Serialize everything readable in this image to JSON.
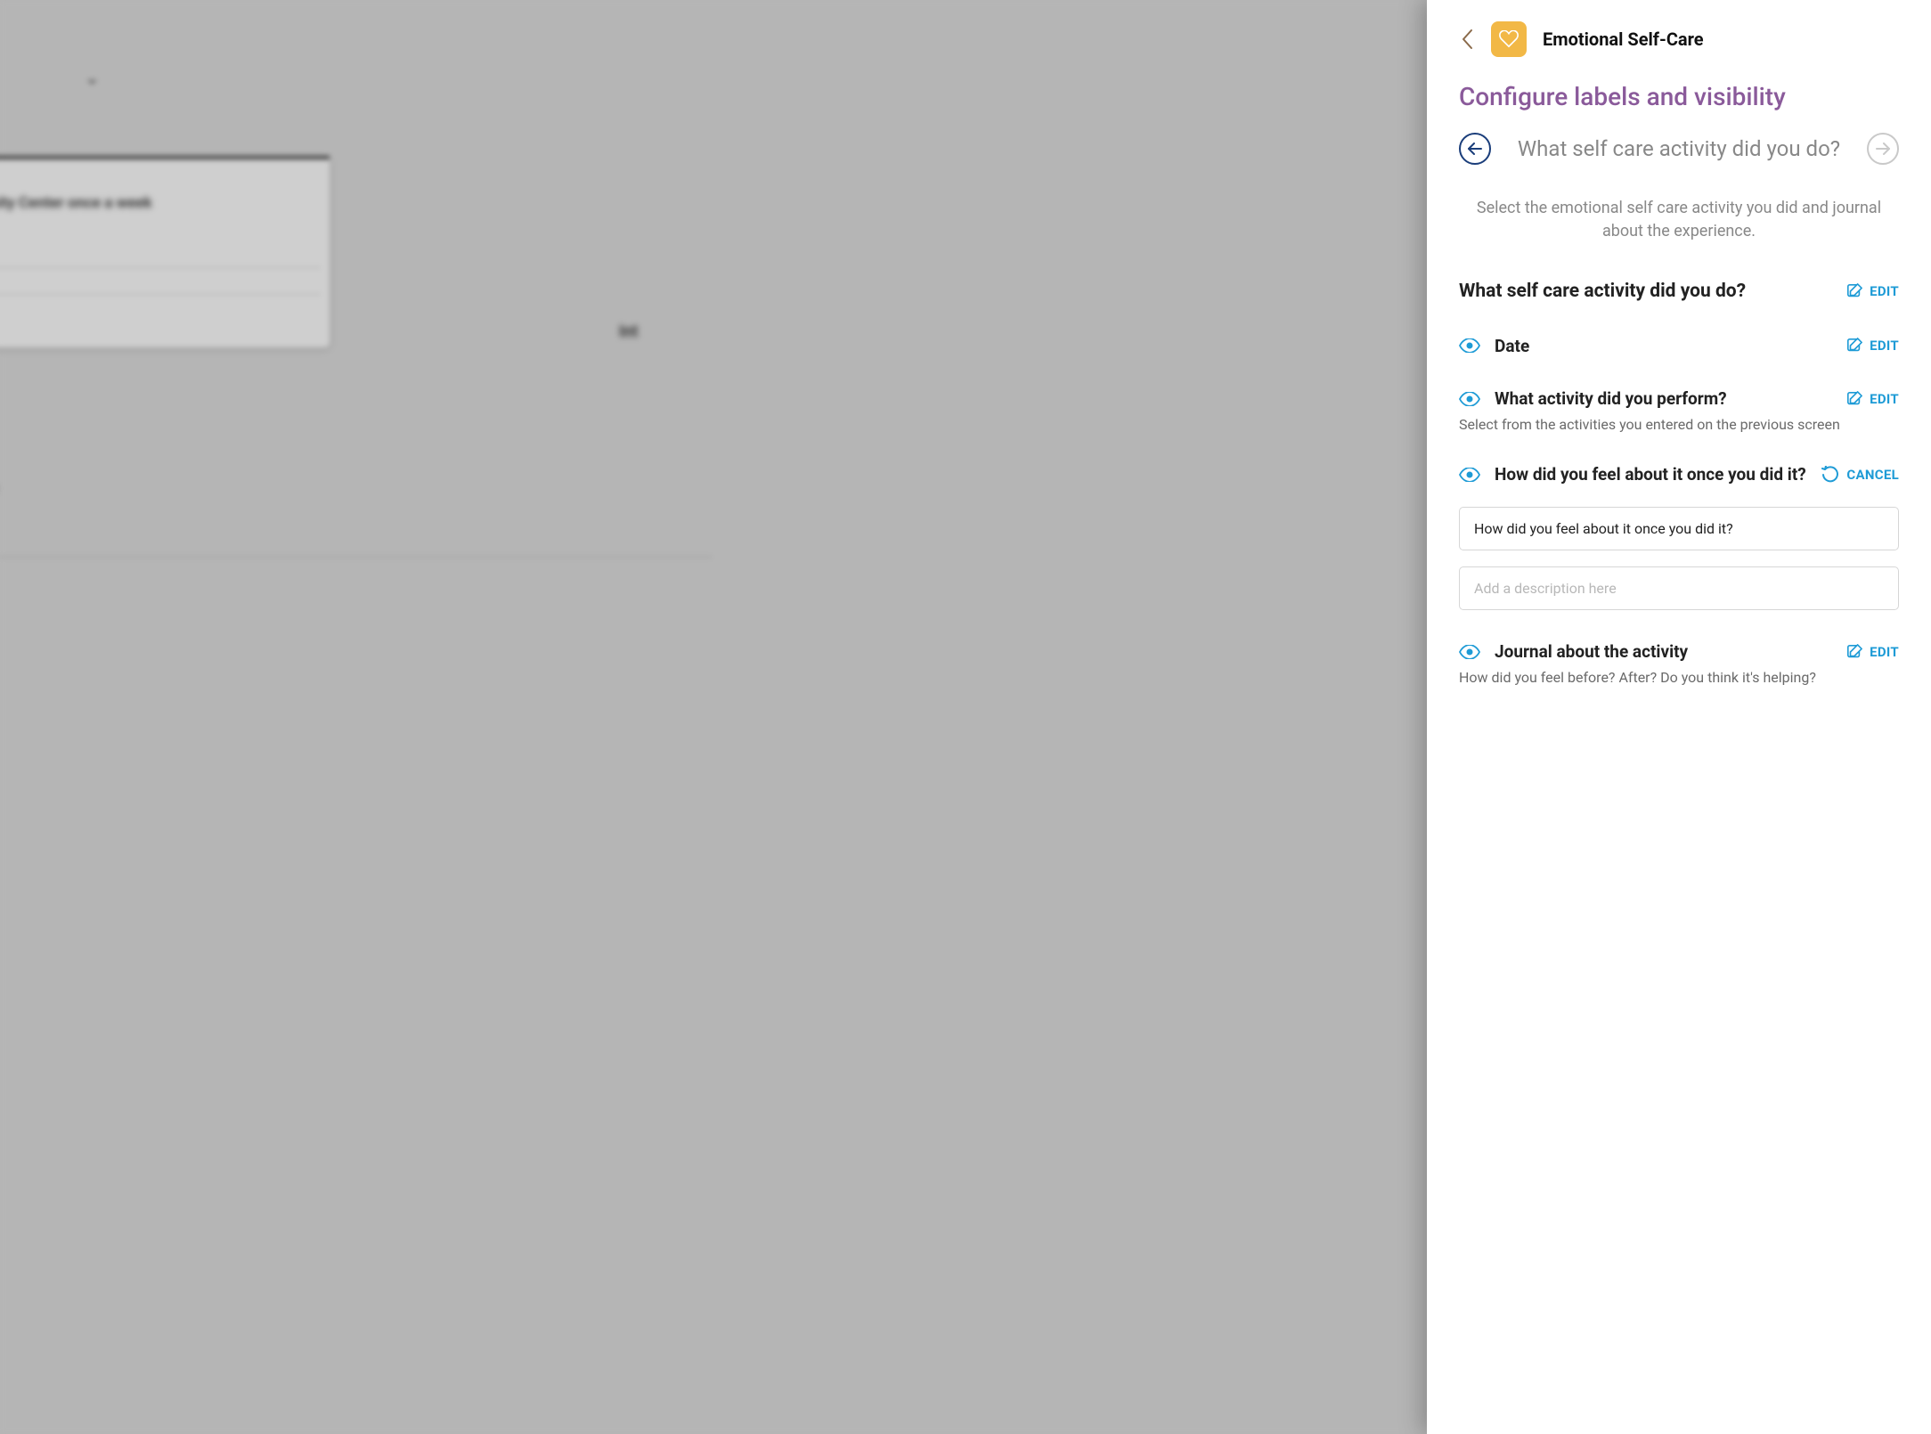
{
  "background": {
    "card_text": "ommunity Center once a week",
    "int_text": "Int",
    "re_text": "re"
  },
  "panel": {
    "title": "Emotional Self-Care",
    "section_heading": "Configure labels and visibility",
    "question_nav_title": "What self care activity did you do?",
    "helper_text": "Select the emotional self care activity you did and journal about the experience.",
    "edit_label": "EDIT",
    "cancel_label": "CANCEL",
    "fields": {
      "main": {
        "label": "What self care activity did you do?"
      },
      "date": {
        "label": "Date"
      },
      "activity": {
        "label": "What activity did you perform?",
        "desc": "Select from the activities you entered on the previous screen"
      },
      "feel": {
        "label": "How did you feel about it once you did it?",
        "input_value": "How did you feel about it once you did it?",
        "desc_placeholder": "Add a description here"
      },
      "journal": {
        "label": "Journal about the activity",
        "desc": "How did you feel before? After? Do you think it's helping?"
      }
    }
  }
}
